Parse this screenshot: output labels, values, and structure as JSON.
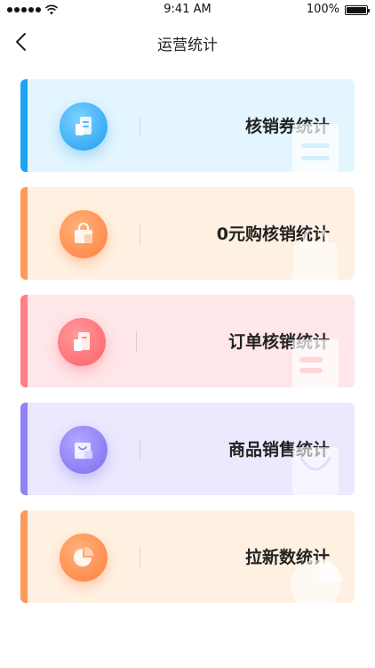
{
  "status_bar": {
    "time": "9:41 AM",
    "battery_percent": "100%",
    "battery_level": 1.0,
    "signal_bars": 5
  },
  "nav": {
    "title": "运营统计",
    "back_icon": "chevron-left-icon"
  },
  "cards": [
    {
      "label": "核销券统计",
      "icon": "ticket-icon",
      "accent": "#1aa4f2",
      "background": "#e3f5fe"
    },
    {
      "label": "0元购核销统计",
      "icon": "shopping-bag-icon",
      "accent": "#fb9a5a",
      "background": "#fff1e2"
    },
    {
      "label": "订单核销统计",
      "icon": "receipt-icon",
      "accent": "#ff7e87",
      "background": "#ffe6e8"
    },
    {
      "label": "商品销售统计",
      "icon": "gift-bag-icon",
      "accent": "#8f83f5",
      "background": "#ece8fe"
    },
    {
      "label": "拉新数统计",
      "icon": "pie-chart-icon",
      "accent": "#fb9a5a",
      "background": "#fff1e2"
    }
  ]
}
